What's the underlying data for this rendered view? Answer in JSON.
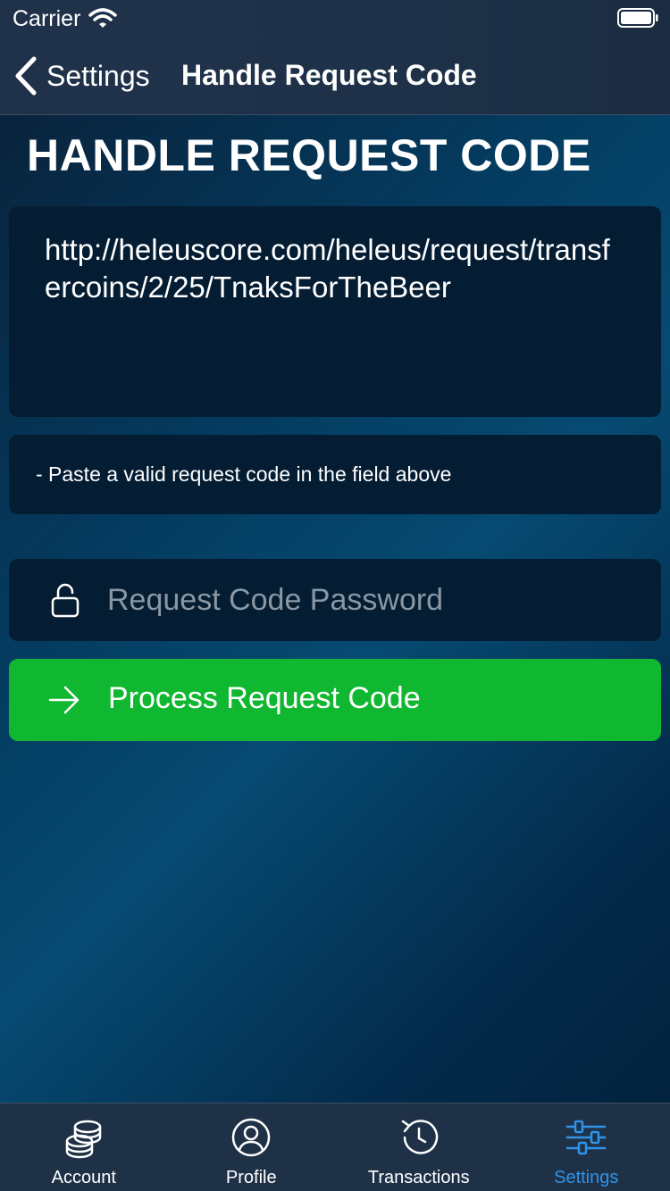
{
  "status_bar": {
    "carrier": "Carrier"
  },
  "nav": {
    "back_label": "Settings",
    "title": "Handle Request Code"
  },
  "page": {
    "heading": "HANDLE REQUEST CODE",
    "request_code": "http://heleuscore.com/heleus/request/transfercoins/2/25/TnaksForTheBeer",
    "info_text": "- Paste a valid request code in the field above",
    "password_placeholder": "Request Code Password",
    "password_value": "",
    "process_button_label": "Process Request Code"
  },
  "colors": {
    "accent": "#2f93e8",
    "process_button": "#10b831",
    "box_background": "#041d33",
    "bar_background": "#1f3147"
  },
  "tabs": [
    {
      "label": "Account",
      "icon": "coins-icon",
      "active": false
    },
    {
      "label": "Profile",
      "icon": "user-circle-icon",
      "active": false
    },
    {
      "label": "Transactions",
      "icon": "history-icon",
      "active": false
    },
    {
      "label": "Settings",
      "icon": "sliders-icon",
      "active": true
    }
  ]
}
